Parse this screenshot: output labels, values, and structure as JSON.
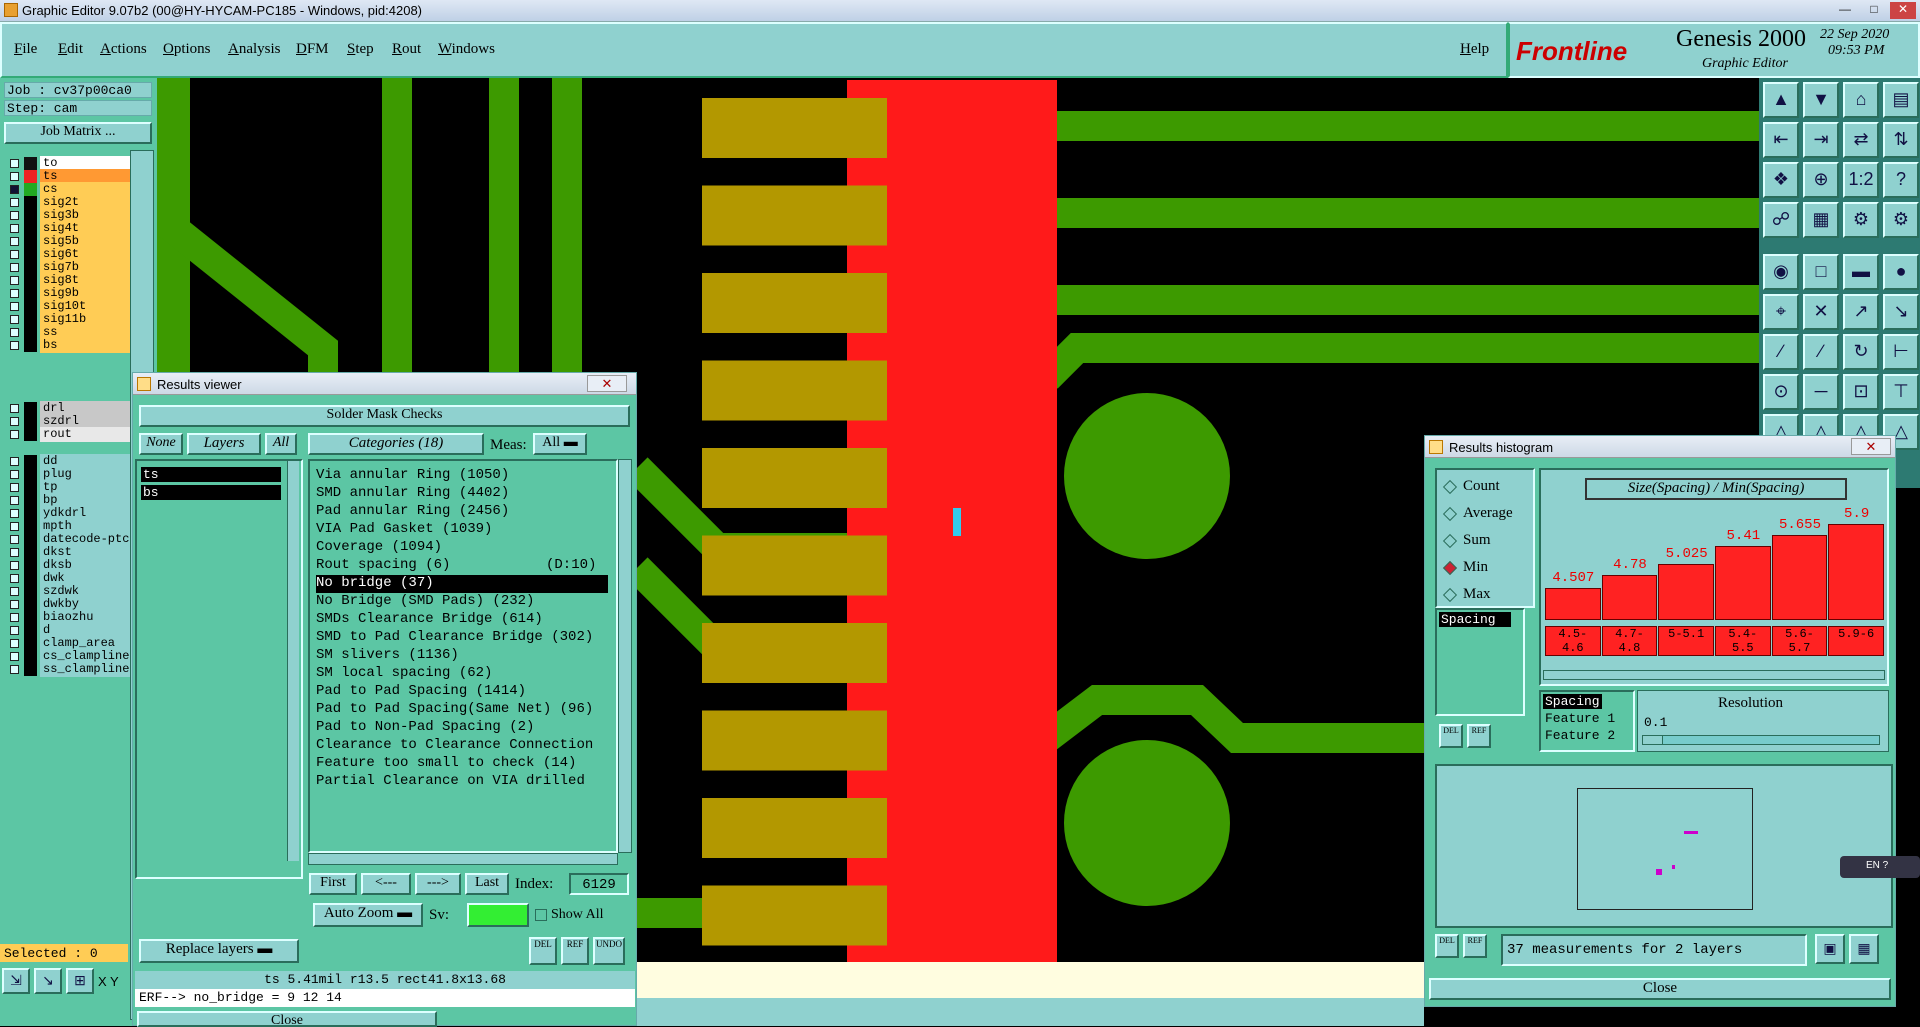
{
  "window": {
    "title": "Graphic Editor 9.07b2 (00@HY-HYCAM-PC185 - Windows, pid:4208)"
  },
  "menu": {
    "items": [
      "File",
      "Edit",
      "Actions",
      "Options",
      "Analysis",
      "DFM",
      "Step",
      "Rout",
      "Windows"
    ],
    "help": "Help"
  },
  "logo": {
    "brand": "Frontline",
    "product": "Genesis 2000",
    "sub": "Graphic Editor",
    "date": "22 Sep 2020",
    "time": "09:53 PM"
  },
  "job": {
    "job": "Job : cv37p00ca0",
    "step": "Step: cam",
    "matrix": "Job Matrix ..."
  },
  "layers": {
    "group1": [
      {
        "name": "to",
        "color": "#ffffff",
        "swatch": "#111"
      },
      {
        "name": "ts",
        "color": "#ff9933",
        "swatch": "#e22"
      },
      {
        "name": "cs",
        "color": "#ffcc55",
        "swatch": "#2a2"
      },
      {
        "name": "sig2t",
        "color": "#ffcc55"
      },
      {
        "name": "sig3b",
        "color": "#ffcc55"
      },
      {
        "name": "sig4t",
        "color": "#ffcc55"
      },
      {
        "name": "sig5b",
        "color": "#ffcc55"
      },
      {
        "name": "sig6t",
        "color": "#ffcc55"
      },
      {
        "name": "sig7b",
        "color": "#ffcc55"
      },
      {
        "name": "sig8t",
        "color": "#ffcc55"
      },
      {
        "name": "sig9b",
        "color": "#ffcc55"
      },
      {
        "name": "sig10t",
        "color": "#ffcc55"
      },
      {
        "name": "sig11b",
        "color": "#ffcc55"
      },
      {
        "name": "ss",
        "color": "#ffcc55"
      },
      {
        "name": "bs",
        "color": "#ffcc55"
      }
    ],
    "group2": [
      {
        "name": "drl",
        "color": "#c8c8c8"
      },
      {
        "name": "szdrl",
        "color": "#c8c8c8"
      },
      {
        "name": "rout",
        "color": "#e8e8e8"
      }
    ],
    "group3": [
      "dd",
      "plug",
      "tp",
      "bp",
      "ydkdrl",
      "mpth",
      "datecode-ptc",
      "dkst",
      "dksb",
      "dwk",
      "szdwk",
      "dwkby",
      "biaozhu",
      "d",
      "clamp_area",
      "cs_clampline",
      "ss_clampline"
    ],
    "selected": "Selected : 0"
  },
  "results_viewer": {
    "title": "Results viewer",
    "heading": "Solder Mask Checks",
    "none": "None",
    "layers": "Layers",
    "all": "All",
    "categories": "Categories (18)",
    "meas_label": "Meas:",
    "meas_value": "All",
    "layer_list": [
      "ts",
      "bs"
    ],
    "cat_list": [
      "Via annular Ring (1050)",
      "SMD annular Ring (4402)",
      "Pad annular Ring (2456)",
      "VIA Pad Gasket (1039)",
      "Coverage (1094)",
      "Rout spacing (6)",
      "No bridge (37)",
      "No Bridge (SMD Pads) (232)",
      "SMDs Clearance Bridge (614)",
      "SMD to Pad Clearance Bridge (302)",
      "SM slivers (1136)",
      "SM local spacing (62)",
      "Pad to Pad Spacing (1414)",
      "Pad to Pad Spacing(Same Net) (96)",
      "Pad to Non-Pad Spacing (2)",
      "Clearance to Clearance Connection",
      "Feature too small to check (14)",
      "Partial Clearance on VIA drilled"
    ],
    "rout_tag": "(D:10)",
    "first": "First",
    "prev": "<---",
    "next": "--->",
    "last": "Last",
    "index_label": "Index:",
    "index_value": "6129",
    "autozoom": "Auto Zoom",
    "sv": "Sv:",
    "showall": "Show All",
    "replace": "Replace layers",
    "del": "DEL",
    "ref": "REF",
    "undo": "UNDO",
    "status1": "ts 5.41mil  r13.5  rect41.8x13.68",
    "status2": "ERF--> no_bridge = 9 12 14",
    "close": "Close"
  },
  "histogram": {
    "title": "Results histogram",
    "options": [
      "Count",
      "Average",
      "Sum",
      "Min",
      "Max"
    ],
    "selected": "Min",
    "chart_title": "Size(Spacing) / Min(Spacing)",
    "spacing": "Spacing",
    "fields": [
      "Spacing",
      "Feature 1",
      "Feature 2"
    ],
    "resolution": "Resolution",
    "res_value": "0.1",
    "measurements": "37 measurements for 2 layers",
    "close": "Close",
    "del": "DEL",
    "ref": "REF"
  },
  "chart_data": {
    "type": "bar",
    "title": "Size(Spacing) / Min(Spacing)",
    "categories": [
      "4.5-4.6",
      "4.7-4.8",
      "5-5.1",
      "5.4-5.5",
      "5.6-5.7",
      "5.9-6"
    ],
    "values": [
      4.507,
      4.78,
      5.025,
      5.41,
      5.655,
      5.9
    ]
  },
  "colors": {
    "panel": "#5cc6a4",
    "menubar": "#8fd1cf",
    "trace": "#3d9a00",
    "mask": "#ff1a1a",
    "pad": "#b39800",
    "bar": "#ff2222"
  },
  "bottom": {
    "xy": "X Y"
  },
  "lang": "EN"
}
